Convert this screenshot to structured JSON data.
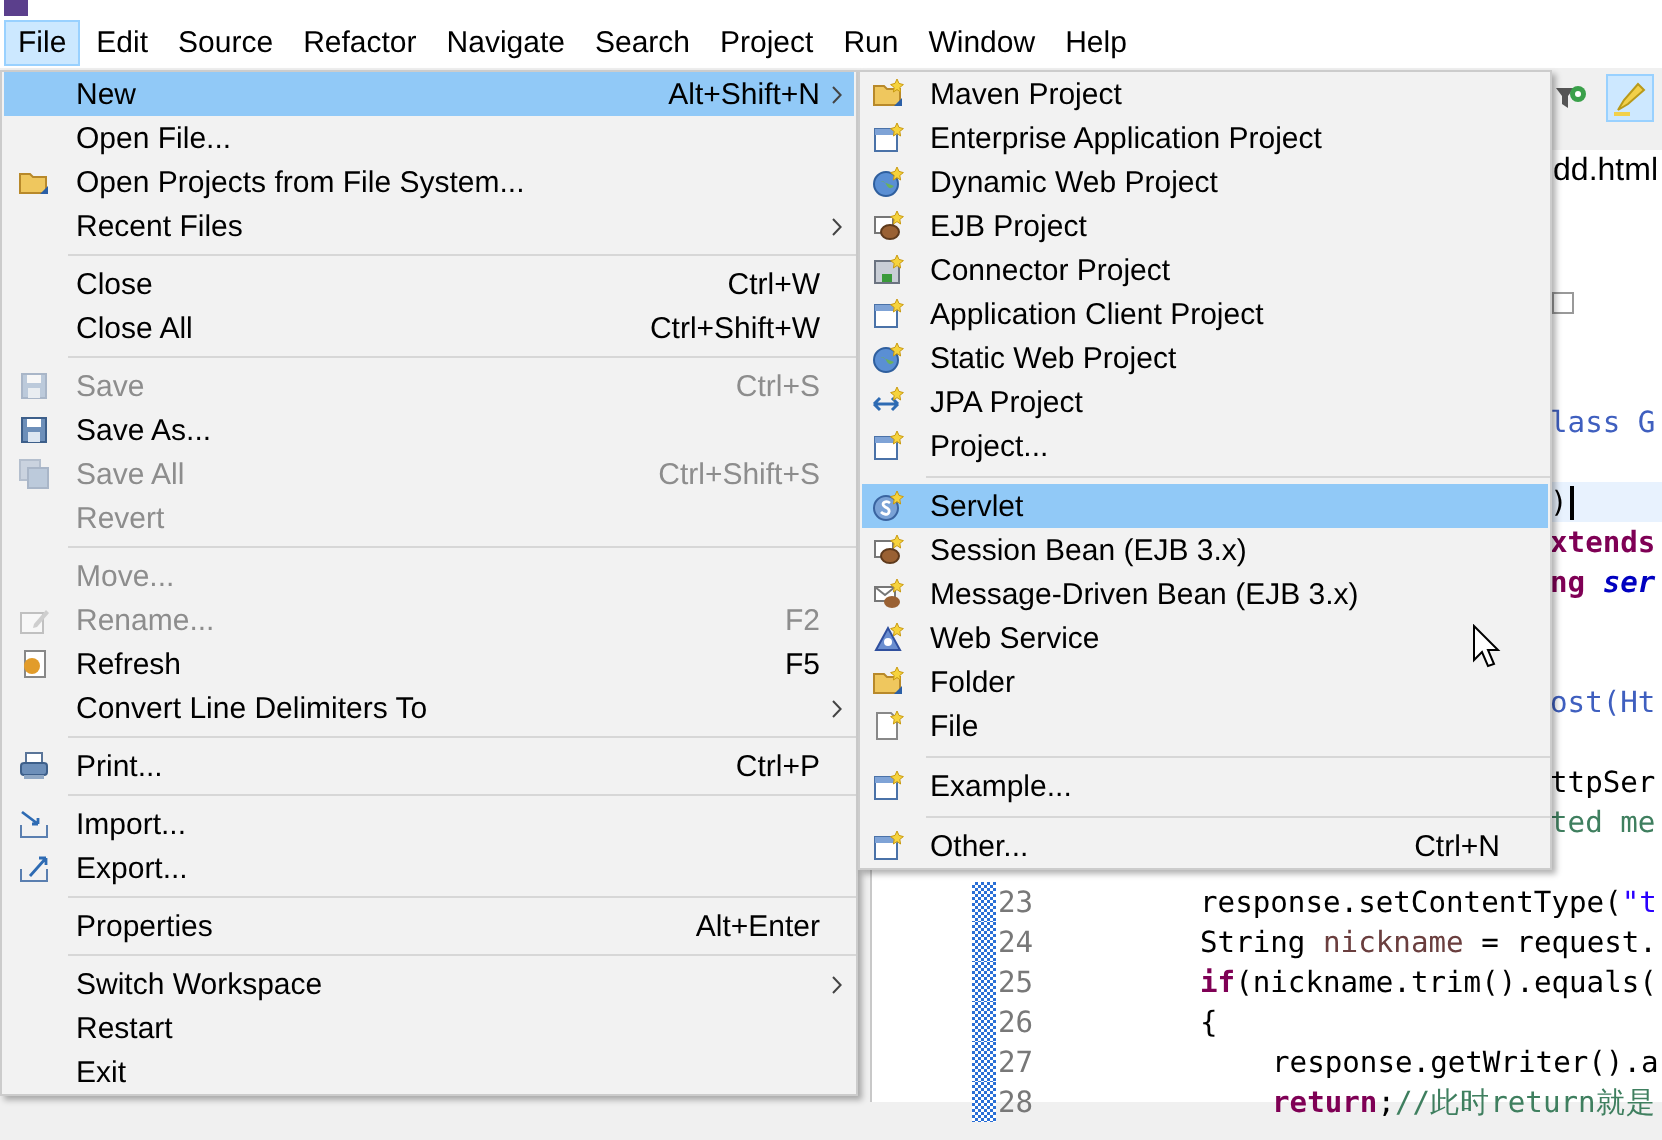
{
  "menu_bar": [
    {
      "label": "File",
      "selected": true
    },
    {
      "label": "Edit",
      "selected": false
    },
    {
      "label": "Source",
      "selected": false
    },
    {
      "label": "Refactor",
      "selected": false
    },
    {
      "label": "Navigate",
      "selected": false
    },
    {
      "label": "Search",
      "selected": false
    },
    {
      "label": "Project",
      "selected": false
    },
    {
      "label": "Run",
      "selected": false
    },
    {
      "label": "Window",
      "selected": false
    },
    {
      "label": "Help",
      "selected": false
    }
  ],
  "file_menu": {
    "items": [
      {
        "kind": "item",
        "label": "New",
        "shortcut": "Alt+Shift+N",
        "submenu": true,
        "selected": true,
        "disabled": false
      },
      {
        "kind": "item",
        "label": "Open File...",
        "selected": false,
        "disabled": false
      },
      {
        "kind": "item",
        "label": "Open Projects from File System...",
        "selected": false,
        "disabled": false
      },
      {
        "kind": "item",
        "label": "Recent Files",
        "submenu": true,
        "selected": false,
        "disabled": false
      },
      {
        "kind": "separator"
      },
      {
        "kind": "item",
        "label": "Close",
        "shortcut": "Ctrl+W",
        "selected": false,
        "disabled": false
      },
      {
        "kind": "item",
        "label": "Close All",
        "shortcut": "Ctrl+Shift+W",
        "selected": false,
        "disabled": false
      },
      {
        "kind": "separator"
      },
      {
        "kind": "item",
        "label": "Save",
        "shortcut": "Ctrl+S",
        "selected": false,
        "disabled": true
      },
      {
        "kind": "item",
        "label": "Save As...",
        "selected": false,
        "disabled": false
      },
      {
        "kind": "item",
        "label": "Save All",
        "shortcut": "Ctrl+Shift+S",
        "selected": false,
        "disabled": true
      },
      {
        "kind": "item",
        "label": "Revert",
        "selected": false,
        "disabled": true
      },
      {
        "kind": "separator"
      },
      {
        "kind": "item",
        "label": "Move...",
        "selected": false,
        "disabled": true
      },
      {
        "kind": "item",
        "label": "Rename...",
        "shortcut": "F2",
        "selected": false,
        "disabled": true
      },
      {
        "kind": "item",
        "label": "Refresh",
        "shortcut": "F5",
        "selected": false,
        "disabled": false
      },
      {
        "kind": "item",
        "label": "Convert Line Delimiters To",
        "submenu": true,
        "selected": false,
        "disabled": false
      },
      {
        "kind": "separator"
      },
      {
        "kind": "item",
        "label": "Print...",
        "shortcut": "Ctrl+P",
        "selected": false,
        "disabled": false
      },
      {
        "kind": "separator"
      },
      {
        "kind": "item",
        "label": "Import...",
        "selected": false,
        "disabled": false
      },
      {
        "kind": "item",
        "label": "Export...",
        "selected": false,
        "disabled": false
      },
      {
        "kind": "separator"
      },
      {
        "kind": "item",
        "label": "Properties",
        "shortcut": "Alt+Enter",
        "selected": false,
        "disabled": false
      },
      {
        "kind": "separator"
      },
      {
        "kind": "item",
        "label": "Switch Workspace",
        "submenu": true,
        "selected": false,
        "disabled": false
      },
      {
        "kind": "item",
        "label": "Restart",
        "selected": false,
        "disabled": false
      },
      {
        "kind": "item",
        "label": "Exit",
        "selected": false,
        "disabled": false
      }
    ]
  },
  "new_submenu": {
    "items": [
      {
        "kind": "item",
        "label": "Maven Project",
        "selected": false,
        "disabled": false
      },
      {
        "kind": "item",
        "label": "Enterprise Application Project",
        "selected": false,
        "disabled": false
      },
      {
        "kind": "item",
        "label": "Dynamic Web Project",
        "selected": false,
        "disabled": false
      },
      {
        "kind": "item",
        "label": "EJB Project",
        "selected": false,
        "disabled": false
      },
      {
        "kind": "item",
        "label": "Connector Project",
        "selected": false,
        "disabled": false
      },
      {
        "kind": "item",
        "label": "Application Client Project",
        "selected": false,
        "disabled": false
      },
      {
        "kind": "item",
        "label": "Static Web Project",
        "selected": false,
        "disabled": false
      },
      {
        "kind": "item",
        "label": "JPA Project",
        "selected": false,
        "disabled": false
      },
      {
        "kind": "item",
        "label": "Project...",
        "selected": false,
        "disabled": false
      },
      {
        "kind": "separator"
      },
      {
        "kind": "item",
        "label": "Servlet",
        "selected": true,
        "disabled": false
      },
      {
        "kind": "item",
        "label": "Session Bean (EJB 3.x)",
        "selected": false,
        "disabled": false
      },
      {
        "kind": "item",
        "label": "Message-Driven Bean (EJB 3.x)",
        "selected": false,
        "disabled": false
      },
      {
        "kind": "item",
        "label": "Web Service",
        "selected": false,
        "disabled": false
      },
      {
        "kind": "item",
        "label": "Folder",
        "selected": false,
        "disabled": false
      },
      {
        "kind": "item",
        "label": "File",
        "selected": false,
        "disabled": false
      },
      {
        "kind": "separator"
      },
      {
        "kind": "item",
        "label": "Example...",
        "selected": false,
        "disabled": false
      },
      {
        "kind": "separator"
      },
      {
        "kind": "item",
        "label": "Other...",
        "shortcut": "Ctrl+N",
        "selected": false,
        "disabled": false
      }
    ]
  },
  "editor": {
    "toolbar": [
      {
        "selected": false
      },
      {
        "selected": true
      }
    ],
    "tabs": [
      {
        "label": "dd.html",
        "selected": true
      }
    ],
    "lines": [
      {
        "kind": "hidden"
      },
      {
        "kind": "hidden"
      },
      {
        "kind": "folded"
      },
      {
        "kind": "hidden"
      },
      {
        "kind": "hidden"
      },
      {
        "kind": "fragment",
        "current": false,
        "tokens": [
          {
            "kind": "javadoc",
            "text": "lass G"
          }
        ]
      },
      {
        "kind": "hidden"
      },
      {
        "kind": "fragment",
        "current": true,
        "tokens": [
          {
            "kind": "plain",
            "text": ")"
          }
        ]
      },
      {
        "kind": "fragment",
        "current": false,
        "tokens": [
          {
            "kind": "keyword",
            "text": "xtends"
          }
        ]
      },
      {
        "kind": "fragment",
        "current": false,
        "tokens": [
          {
            "kind": "keyword",
            "text": "ng"
          },
          {
            "kind": "field",
            "text": " ser"
          }
        ]
      },
      {
        "kind": "hidden"
      },
      {
        "kind": "hidden"
      },
      {
        "kind": "fragment",
        "current": false,
        "tokens": [
          {
            "kind": "javadoc",
            "text": "ost(Ht"
          }
        ]
      },
      {
        "kind": "hidden"
      },
      {
        "kind": "fragment",
        "current": false,
        "tokens": [
          {
            "kind": "plain",
            "text": "ttpSer"
          }
        ]
      },
      {
        "kind": "fragment",
        "current": false,
        "tokens": [
          {
            "kind": "comment",
            "text": "ted me"
          }
        ]
      },
      {
        "kind": "hidden"
      },
      {
        "kind": "line",
        "number": "23",
        "current": false,
        "tokens": [
          {
            "kind": "plain",
            "text": "response.setContentType("
          },
          {
            "kind": "string",
            "text": "\"t"
          }
        ]
      },
      {
        "kind": "line",
        "number": "24",
        "current": false,
        "tokens": [
          {
            "kind": "plain",
            "text": "String "
          },
          {
            "kind": "local",
            "text": "nickname"
          },
          {
            "kind": "plain",
            "text": " = request."
          }
        ]
      },
      {
        "kind": "line",
        "number": "25",
        "current": false,
        "tokens": [
          {
            "kind": "keyword",
            "text": "if"
          },
          {
            "kind": "plain",
            "text": "(nickname.trim().equals("
          }
        ]
      },
      {
        "kind": "line",
        "number": "26",
        "current": false,
        "tokens": [
          {
            "kind": "plain",
            "text": "{"
          }
        ],
        "children": [
          {
            "kind": "line",
            "number": "27",
            "current": false,
            "tokens": [
              {
                "kind": "plain",
                "text": "response.getWriter().a"
              }
            ]
          },
          {
            "kind": "line",
            "number": "28",
            "current": false,
            "tokens": [
              {
                "kind": "keyword",
                "text": "return"
              },
              {
                "kind": "plain",
                "text": ";"
              },
              {
                "kind": "comment",
                "text": "//此时return就是"
              }
            ]
          }
        ]
      }
    ]
  }
}
